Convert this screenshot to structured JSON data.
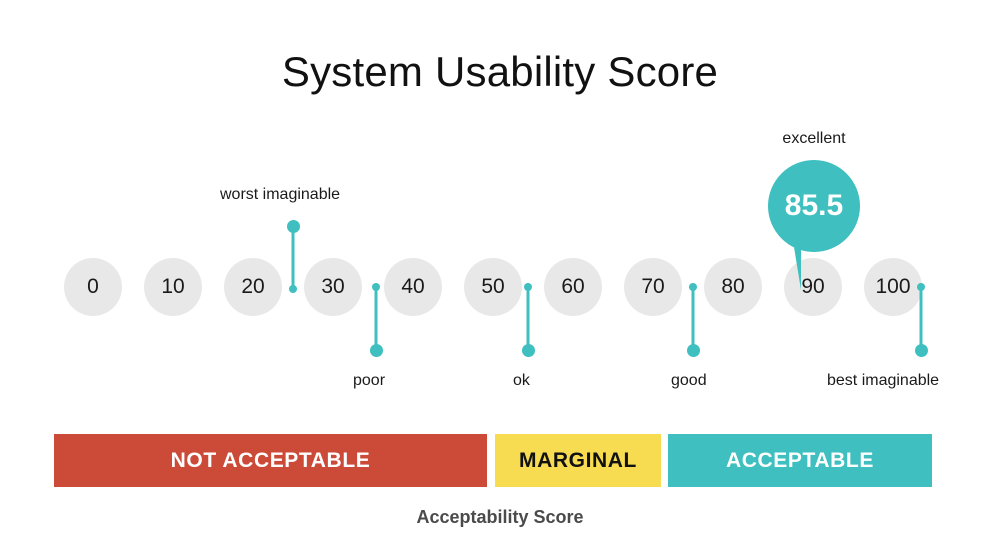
{
  "chart_data": {
    "type": "bar",
    "title": "System Usability Score",
    "xlabel": "",
    "ylabel": "",
    "score": 85.5,
    "score_rating": "excellent",
    "scale_min": 0,
    "scale_max": 100,
    "scale_ticks": [
      0,
      10,
      20,
      30,
      40,
      50,
      60,
      70,
      80,
      90,
      100
    ],
    "adjective_ratings": [
      {
        "label": "worst imaginable",
        "value": 25,
        "position": "above"
      },
      {
        "label": "poor",
        "value": 39,
        "position": "below"
      },
      {
        "label": "ok",
        "value": 52,
        "position": "below"
      },
      {
        "label": "good",
        "value": 73,
        "position": "below"
      },
      {
        "label": "excellent",
        "value": 85.5,
        "position": "above"
      },
      {
        "label": "best imaginable",
        "value": 100,
        "position": "below"
      }
    ],
    "acceptability_segments": [
      {
        "label": "NOT ACCEPTABLE",
        "color": "#cc4b38",
        "text_color": "#ffffff",
        "range": [
          0,
          50
        ]
      },
      {
        "label": "MARGINAL",
        "color": "#f7dc52",
        "text_color": "#111111",
        "range": [
          50,
          70
        ]
      },
      {
        "label": "ACCEPTABLE",
        "color": "#3fbfbf",
        "text_color": "#ffffff",
        "range": [
          70,
          100
        ]
      }
    ],
    "acceptability_caption": "Acceptability Score",
    "grid": false,
    "legend": "none"
  },
  "header": {
    "title": "System Usability Score"
  },
  "scale": {
    "circles": [
      {
        "label": "0"
      },
      {
        "label": "10"
      },
      {
        "label": "20"
      },
      {
        "label": "30"
      },
      {
        "label": "40"
      },
      {
        "label": "50"
      },
      {
        "label": "60"
      },
      {
        "label": "70"
      },
      {
        "label": "80"
      },
      {
        "label": "90"
      },
      {
        "label": "100"
      }
    ]
  },
  "markers": {
    "worst_imaginable": "worst imaginable",
    "poor": "poor",
    "ok": "ok",
    "good": "good",
    "best_imaginable": "best imaginable"
  },
  "score_bubble": {
    "value": "85.5",
    "rating": "excellent"
  },
  "acceptability": {
    "not_acceptable": "NOT ACCEPTABLE",
    "marginal": "MARGINAL",
    "acceptable": "ACCEPTABLE",
    "caption": "Acceptability Score"
  },
  "colors": {
    "teal": "#3fbfbf",
    "red": "#cc4b38",
    "yellow": "#f7dc52",
    "circle_gray": "#e8e8e8",
    "text_dark": "#1a1a1a",
    "caption_gray": "#4a4a4a"
  }
}
